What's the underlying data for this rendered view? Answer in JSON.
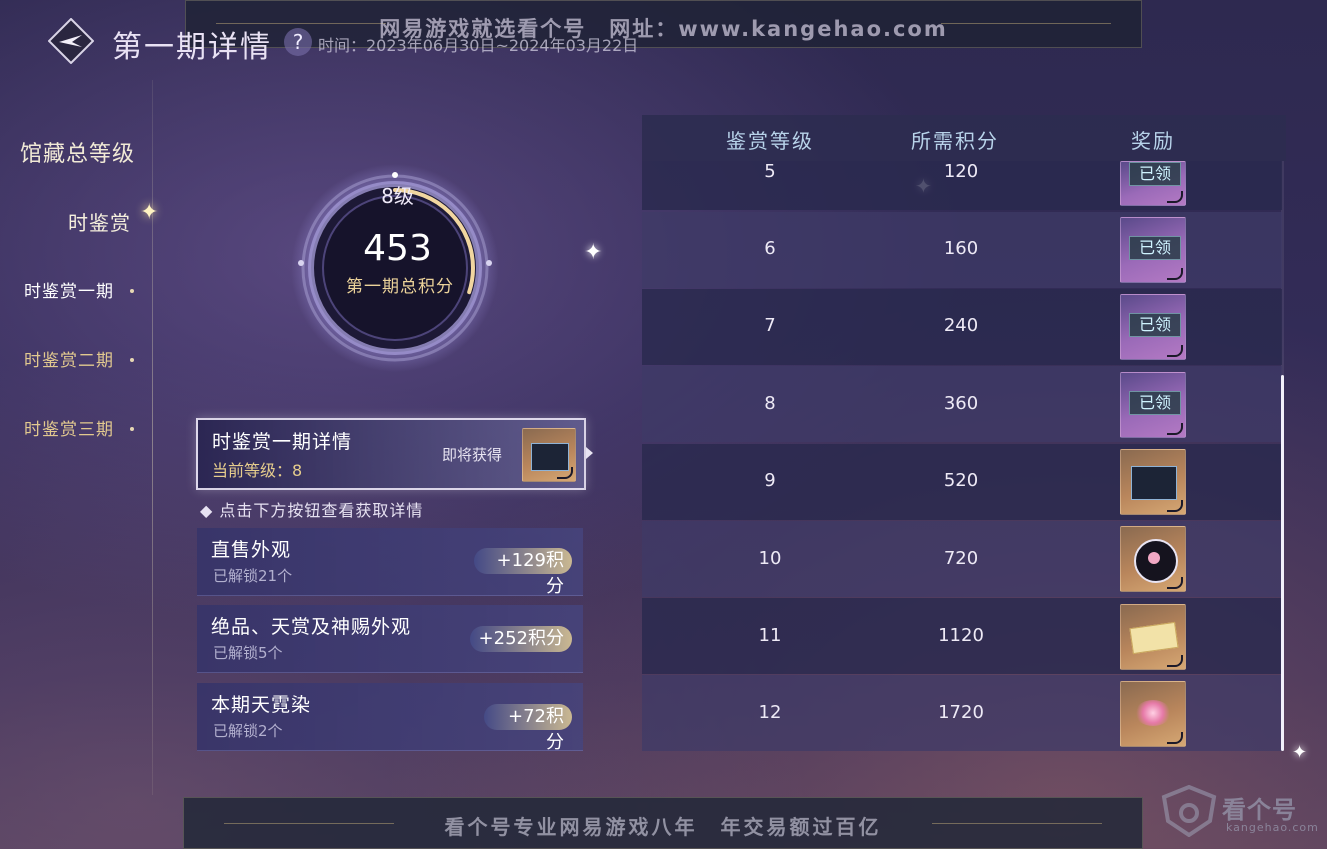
{
  "watermark_top": "网易游戏就选看个号　网址：www.kangehao.com",
  "watermark_bottom": "看个号专业网易游戏八年　年交易额过百亿",
  "watermark_brand": "看个号",
  "watermark_brand_url": "kangehao.com",
  "header": {
    "title": "第一期详情",
    "help_symbol": "?",
    "period": "时间：2023年06月30日~2024年03月22日"
  },
  "nav": {
    "total": "馆藏总等级",
    "group": "时鉴赏",
    "items": [
      {
        "label": "时鉴赏一期",
        "active": true
      },
      {
        "label": "时鉴赏二期",
        "active": false
      },
      {
        "label": "时鉴赏三期",
        "active": false
      }
    ]
  },
  "ring": {
    "level": "8级",
    "score": "453",
    "caption": "第一期总积分",
    "progress_fraction": 0.3
  },
  "detail": {
    "title": "时鉴赏一期详情",
    "current_level": "当前等级：8",
    "coming_label": "即将获得"
  },
  "hint": "◆ 点击下方按钮查看获取详情",
  "sources": [
    {
      "title": "直售外观",
      "sub": "已解锁21个",
      "points": "+129积分"
    },
    {
      "title": "绝品、天赏及神赐外观",
      "sub": "已解锁5个",
      "points": "+252积分"
    },
    {
      "title": "本期天霓染",
      "sub": "已解锁2个",
      "points": "+72积分"
    }
  ],
  "table": {
    "headers": [
      "鉴赏等级",
      "所需积分",
      "奖励"
    ],
    "claimed_label": "已领",
    "rows": [
      {
        "level": "5",
        "points": "120",
        "claimed": true,
        "style": "purple"
      },
      {
        "level": "6",
        "points": "160",
        "claimed": true,
        "style": "purple"
      },
      {
        "level": "7",
        "points": "240",
        "claimed": true,
        "style": "purple"
      },
      {
        "level": "8",
        "points": "360",
        "claimed": true,
        "style": "purple"
      },
      {
        "level": "9",
        "points": "520",
        "claimed": false,
        "style": "gold",
        "icon": "frame-icon"
      },
      {
        "level": "10",
        "points": "720",
        "claimed": false,
        "style": "gold",
        "icon": "flower-orb-icon"
      },
      {
        "level": "11",
        "points": "1120",
        "claimed": false,
        "style": "gold",
        "icon": "scroll-icon"
      },
      {
        "level": "12",
        "points": "1720",
        "claimed": false,
        "style": "gold",
        "icon": "pink-glow-icon"
      }
    ]
  },
  "colors": {
    "gold_text": "#e6cd8d",
    "header_text": "#b8d3ea",
    "claimed_text": "#cff3ff"
  }
}
